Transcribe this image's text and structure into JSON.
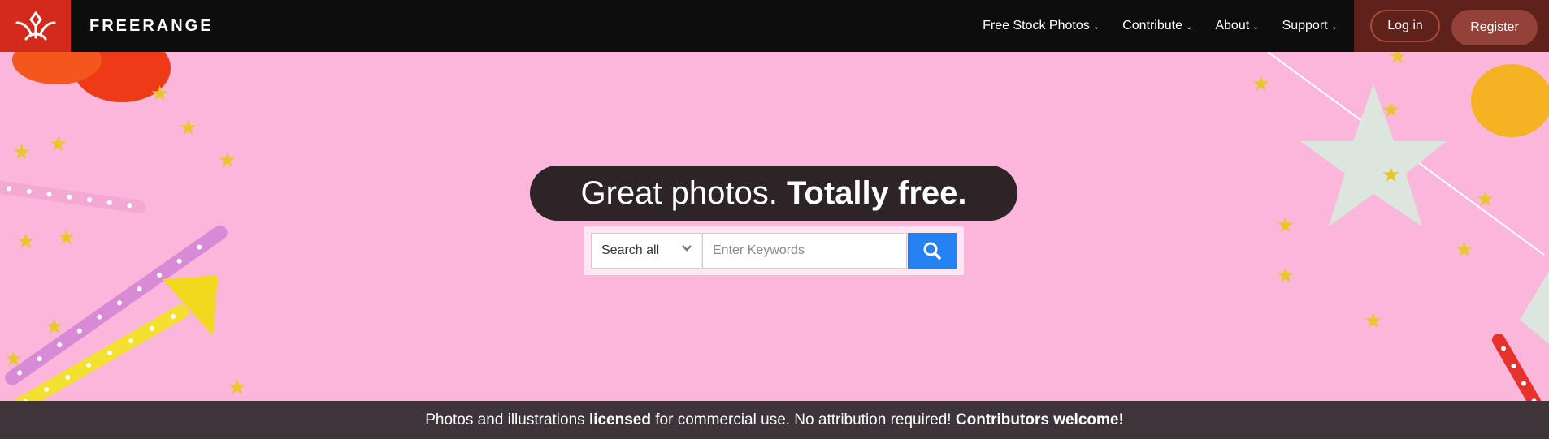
{
  "brand": {
    "name": "FREERANGE",
    "logo_icon": "leaf-logo-icon",
    "logo_color": "#d42a1d"
  },
  "nav": {
    "items": [
      {
        "label": "Free Stock Photos",
        "name": "nav-free-stock-photos"
      },
      {
        "label": "Contribute",
        "name": "nav-contribute"
      },
      {
        "label": "About",
        "name": "nav-about"
      },
      {
        "label": "Support",
        "name": "nav-support"
      }
    ],
    "login_label": "Log in",
    "register_label": "Register"
  },
  "hero": {
    "headline_regular": "Great photos.",
    "headline_bold": "Totally free.",
    "background_color": "#fbb6dc"
  },
  "search": {
    "category_value": "Search all",
    "placeholder": "Enter Keywords",
    "button_color": "#2681f2"
  },
  "strip": {
    "part1": "Photos and illustrations",
    "part2": "licensed",
    "part3": "for commercial use. No attribution required!",
    "part4": "Contributors welcome!"
  }
}
